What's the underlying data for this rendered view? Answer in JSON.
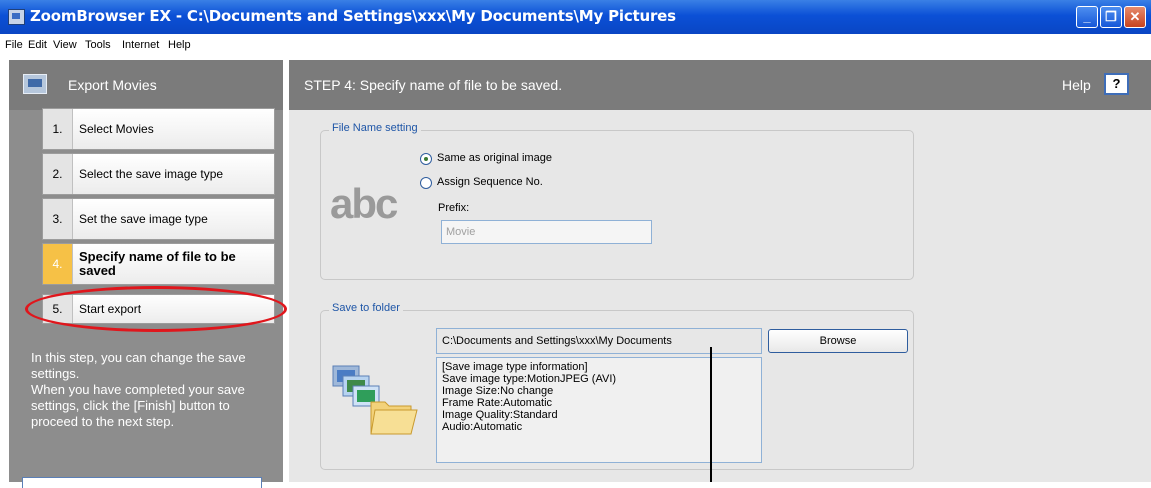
{
  "window": {
    "title": "ZoomBrowser EX  -  C:\\Documents and Settings\\xxx\\My Documents\\My Pictures",
    "min_glyph": "_",
    "max_glyph": "❐",
    "close_glyph": "✕"
  },
  "menu": [
    "File",
    "Edit",
    "View",
    "Tools",
    "Internet",
    "Help"
  ],
  "left_panel": {
    "title": "Export Movies",
    "steps": [
      {
        "num": "1.",
        "label": "Select Movies"
      },
      {
        "num": "2.",
        "label": "Select the save image type"
      },
      {
        "num": "3.",
        "label": "Set the save image type"
      },
      {
        "num": "4.",
        "label": "Specify name of file to be saved"
      },
      {
        "num": "5.",
        "label": "Start export"
      }
    ],
    "description": "In this step, you can change the save settings.\n When you have completed your save settings, click the [Finish] button to proceed to the next step."
  },
  "main": {
    "step_title": "STEP 4: Specify name of file to be saved.",
    "help_label": "Help",
    "help_button": "?",
    "file_name_setting": {
      "legend": "File Name setting",
      "graphic_text": "abc",
      "option_same": "Same as original image",
      "option_sequence": "Assign Sequence No.",
      "selected": "Same as original image",
      "prefix_label": "Prefix:",
      "prefix_value": "Movie"
    },
    "save_to_folder": {
      "legend": "Save to folder",
      "path": "C:\\Documents and Settings\\xxx\\My Documents",
      "browse_label": "Browse",
      "info_lines": [
        "[Save image type information]",
        "Save image type:MotionJPEG (AVI)",
        "Image Size:No change",
        "Frame Rate:Automatic",
        "Image Quality:Standard",
        "Audio:Automatic"
      ]
    }
  },
  "colors": {
    "titlebar": "#0b50d6",
    "panel_gray": "#8d8d8d",
    "header_gray": "#7b7b7b",
    "active_step": "#f6c146",
    "highlight_oval": "#e0161c",
    "legend_blue": "#1f56a7"
  }
}
